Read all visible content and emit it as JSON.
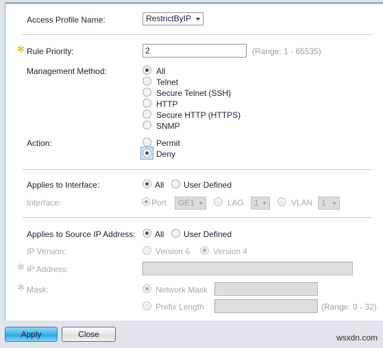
{
  "dialog": {
    "fields": {
      "access_profile_name_label": "Access Profile Name:",
      "access_profile_name_value": "RestrictByIP",
      "rule_priority_label": "Rule Priority:",
      "rule_priority_value": "2",
      "rule_priority_hint": "(Range: 1 - 65535)",
      "management_method_label": "Management Method:",
      "action_label": "Action:",
      "applies_to_interface_label": "Applies to Interface:",
      "interface_label": "Interface:",
      "applies_to_source_ip_label": "Applies to Source IP Address:",
      "ip_version_label": "IP Version:",
      "ip_address_label": "IP Address:",
      "ip_address_value": "",
      "mask_label": "Mask:"
    },
    "management_methods": [
      {
        "label": "All",
        "selected": true
      },
      {
        "label": "Telnet",
        "selected": false
      },
      {
        "label": "Secure Telnet (SSH)",
        "selected": false
      },
      {
        "label": "HTTP",
        "selected": false
      },
      {
        "label": "Secure HTTP (HTTPS)",
        "selected": false
      },
      {
        "label": "SNMP",
        "selected": false
      }
    ],
    "actions": [
      {
        "label": "Permit",
        "selected": false
      },
      {
        "label": "Deny",
        "selected": true,
        "focused": true
      }
    ],
    "applies_to_interface": [
      {
        "label": "All",
        "selected": true
      },
      {
        "label": "User Defined",
        "selected": false
      }
    ],
    "interface_options": [
      {
        "label": "Port",
        "selected": true,
        "value": "GE1"
      },
      {
        "label": "LAG",
        "selected": false,
        "value": "1"
      },
      {
        "label": "VLAN",
        "selected": false,
        "value": "1"
      }
    ],
    "applies_to_source_ip": [
      {
        "label": "All",
        "selected": true
      },
      {
        "label": "User Defined",
        "selected": false
      }
    ],
    "ip_versions": [
      {
        "label": "Version 6",
        "selected": false
      },
      {
        "label": "Version 4",
        "selected": true
      }
    ],
    "mask_options": [
      {
        "label": "Network Mask",
        "selected": true,
        "value": "",
        "hint": ""
      },
      {
        "label": "Prefix Length",
        "selected": false,
        "value": "",
        "hint": "(Range: 0 - 32)"
      }
    ],
    "buttons": {
      "apply": "Apply",
      "close": "Close"
    },
    "required_marker": "✻",
    "watermark": "wsxdn.com",
    "colors": {
      "accent": "#27a6e3",
      "required_star": "#f0a30a",
      "focus_ring": "#6fa8dc",
      "background": "#dfe5ea"
    }
  }
}
